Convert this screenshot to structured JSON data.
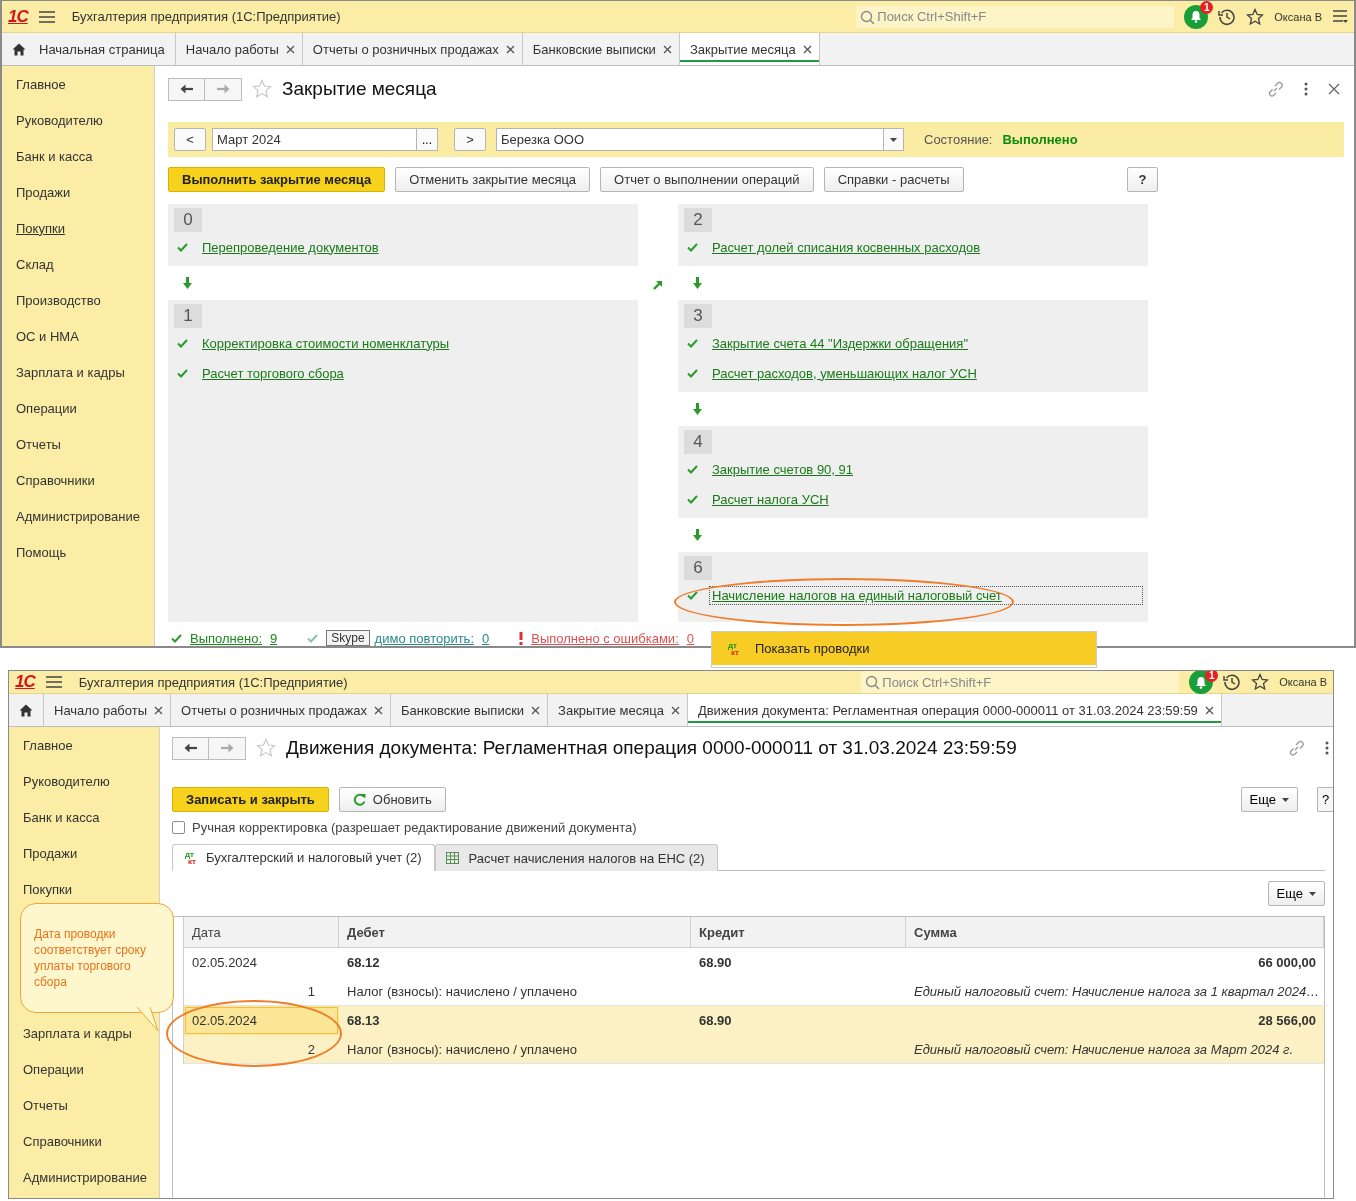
{
  "top_window": {
    "header": {
      "logo": "1С",
      "app_title": "Бухгалтерия предприятия  (1С:Предприятие)",
      "search_placeholder": "Поиск Ctrl+Shift+F",
      "notification_count": "1",
      "user": "Оксана В"
    },
    "home_tab": {
      "label": "Начальная страница"
    },
    "tabs": [
      {
        "label": "Начало работы",
        "selected": false
      },
      {
        "label": "Отчеты о розничных продажах",
        "selected": false
      },
      {
        "label": "Банковские выписки",
        "selected": false
      },
      {
        "label": "Закрытие месяца",
        "selected": true
      }
    ],
    "sidebar": [
      {
        "label": "Главное",
        "hovered": false
      },
      {
        "label": "Руководителю",
        "hovered": false
      },
      {
        "label": "Банк и касса",
        "hovered": false
      },
      {
        "label": "Продажи",
        "hovered": false
      },
      {
        "label": "Покупки",
        "hovered": true
      },
      {
        "label": "Склад",
        "hovered": false
      },
      {
        "label": "Производство",
        "hovered": false
      },
      {
        "label": "ОС и НМА",
        "hovered": false
      },
      {
        "label": "Зарплата и кадры",
        "hovered": false
      },
      {
        "label": "Операции",
        "hovered": false
      },
      {
        "label": "Отчеты",
        "hovered": false
      },
      {
        "label": "Справочники",
        "hovered": false
      },
      {
        "label": "Администрирование",
        "hovered": false
      },
      {
        "label": "Помощь",
        "hovered": false
      }
    ],
    "form": {
      "title": "Закрытие месяца",
      "prev": "<",
      "period": "Март 2024",
      "period_button": "...",
      "next": ">",
      "organization": "Березка ООО",
      "state_label": "Состояние:",
      "state_value": "Выполнено",
      "buttons": [
        {
          "label": "Выполнить закрытие месяца",
          "kind": "primary"
        },
        {
          "label": "Отменить закрытие месяца",
          "kind": "normal"
        },
        {
          "label": "Отчет о выполнении операций",
          "kind": "normal"
        },
        {
          "label": "Справки - расчеты",
          "kind": "normal"
        },
        {
          "label": "?",
          "kind": "help"
        }
      ],
      "steps_left": [
        {
          "number": "0",
          "items": [
            {
              "label": "Перепроведение документов",
              "done": true,
              "focused": false
            }
          ]
        },
        {
          "number": "1",
          "items": [
            {
              "label": "Корректировка стоимости номенклатуры",
              "done": true,
              "focused": false
            },
            {
              "label": "Расчет торгового сбора",
              "done": true,
              "focused": false
            }
          ]
        }
      ],
      "steps_right": [
        {
          "number": "2",
          "items": [
            {
              "label": "Расчет долей списания косвенных расходов",
              "done": true,
              "focused": false
            }
          ]
        },
        {
          "number": "3",
          "items": [
            {
              "label": "Закрытие счета 44 \"Издержки обращения\"",
              "done": true,
              "focused": false
            },
            {
              "label": "Расчет расходов, уменьшающих налог УСН",
              "done": true,
              "focused": false
            }
          ]
        },
        {
          "number": "4",
          "items": [
            {
              "label": "Закрытие счетов 90, 91",
              "done": true,
              "focused": false
            },
            {
              "label": "Расчет налога УСН",
              "done": true,
              "focused": false
            }
          ]
        },
        {
          "number": "6",
          "items": [
            {
              "label": "Начисление налогов на единый налоговый счет",
              "done": true,
              "focused": true
            }
          ]
        }
      ],
      "status": [
        {
          "kind": "done",
          "label": "Выполнено:",
          "count": "9"
        },
        {
          "kind": "repeat",
          "label": "димо повторить:",
          "count": "0",
          "tooltip": "Skype"
        },
        {
          "kind": "error",
          "label": "Выполнено с ошибками:",
          "count": "0"
        }
      ]
    },
    "popup": {
      "icon_top": "дт",
      "icon_bottom": "кт",
      "label": "Показать проводки"
    }
  },
  "bottom_window": {
    "header": {
      "logo": "1С",
      "app_title": "Бухгалтерия предприятия  (1С:Предприятие)",
      "search_placeholder": "Поиск Ctrl+Shift+F",
      "notification_count": "1",
      "user": "Оксана В"
    },
    "tabs": [
      {
        "label": "Начало работы",
        "selected": false
      },
      {
        "label": "Отчеты о розничных продажах",
        "selected": false
      },
      {
        "label": "Банковские выписки",
        "selected": false
      },
      {
        "label": "Закрытие месяца",
        "selected": false
      },
      {
        "label": "Движения документа: Регламентная операция 0000-000011 от 31.03.2024 23:59:59",
        "selected": true
      }
    ],
    "sidebar_upper": [
      {
        "label": "Главное",
        "hovered": false
      },
      {
        "label": "Руководителю",
        "hovered": false
      },
      {
        "label": "Банк и касса",
        "hovered": false
      },
      {
        "label": "Продажи",
        "hovered": false
      },
      {
        "label": "Покупки",
        "hovered": false
      }
    ],
    "sidebar_lower": [
      {
        "label": "Зарплата и кадры",
        "hovered": false
      },
      {
        "label": "Операции",
        "hovered": false
      },
      {
        "label": "Отчеты",
        "hovered": false
      },
      {
        "label": "Справочники",
        "hovered": false
      },
      {
        "label": "Администрирование",
        "hovered": false
      }
    ],
    "form": {
      "title": "Движения документа: Регламентная операция 0000-000011 от 31.03.2024 23:59:59",
      "buttons": [
        {
          "label": "Записать и закрыть",
          "kind": "primary"
        },
        {
          "label": "Обновить",
          "kind": "refresh"
        }
      ],
      "more_button": "Еще",
      "help_button": "?",
      "manual_edit": {
        "label": "Ручная корректировка (разрешает редактирование движений документа)",
        "checked": false
      },
      "form_tabs": [
        {
          "label": "Бухгалтерский и налоговый учет (2)",
          "selected": true,
          "kind": "entries",
          "icon_top": "дт",
          "icon_bottom": "кт"
        },
        {
          "label": "Расчет начисления налогов на ЕНС (2)",
          "selected": false,
          "kind": "grid"
        }
      ],
      "table_more_button": "Еще",
      "table": {
        "columns": [
          "Дата",
          "Дебет",
          "Кредит",
          "Сумма"
        ],
        "rows": [
          {
            "date": "02.05.2024",
            "number": "1",
            "debit": "68.12",
            "debit_subconto": "Налог (взносы): начислено / уплачено",
            "credit": "68.90",
            "amount": "66 000,00",
            "content": "Единый налоговый счет: Начисление налога за 1 квартал 2024…",
            "selected": false
          },
          {
            "date": "02.05.2024",
            "number": "2",
            "debit": "68.13",
            "debit_subconto": "Налог (взносы): начислено / уплачено",
            "credit": "68.90",
            "amount": "28 566,00",
            "content": "Единый налоговый счет: Начисление налога за Март 2024 г.",
            "selected": true
          }
        ]
      }
    },
    "callout": {
      "text": "Дата проводки соответствует сроку уплаты торгового сбора"
    }
  }
}
